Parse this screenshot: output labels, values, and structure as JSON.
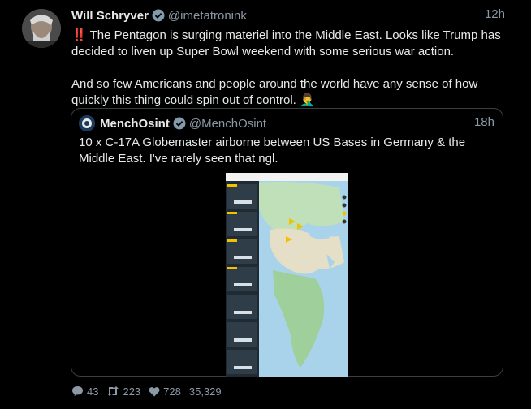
{
  "tweet": {
    "author_name": "Will Schryver",
    "author_handle": "@imetatronink",
    "time": "12h",
    "text_line1": "The Pentagon is surging materiel into the Middle East. Looks like Trump has decided to liven up Super Bowl weekend with some serious war action.",
    "text_line2": "And so few Americans and people around the world have any sense of how quickly this thing could spin out of control. 🤦‍♂️",
    "bang": "‼️"
  },
  "quote": {
    "author_name": "MenchOsint",
    "author_handle": "@MenchOsint",
    "time": "18h",
    "text": "10 x C-17A Globemaster airborne between US Bases in Germany & the Middle East. I've rarely seen that ngl."
  },
  "actions": {
    "replies": "43",
    "retweets": "223",
    "likes": "728",
    "views": "35,329"
  },
  "colors": {
    "background": "#000000",
    "text": "#e7e9ea",
    "muted": "#8b98a5",
    "verified": "#829aab",
    "border": "#3a3f44"
  }
}
